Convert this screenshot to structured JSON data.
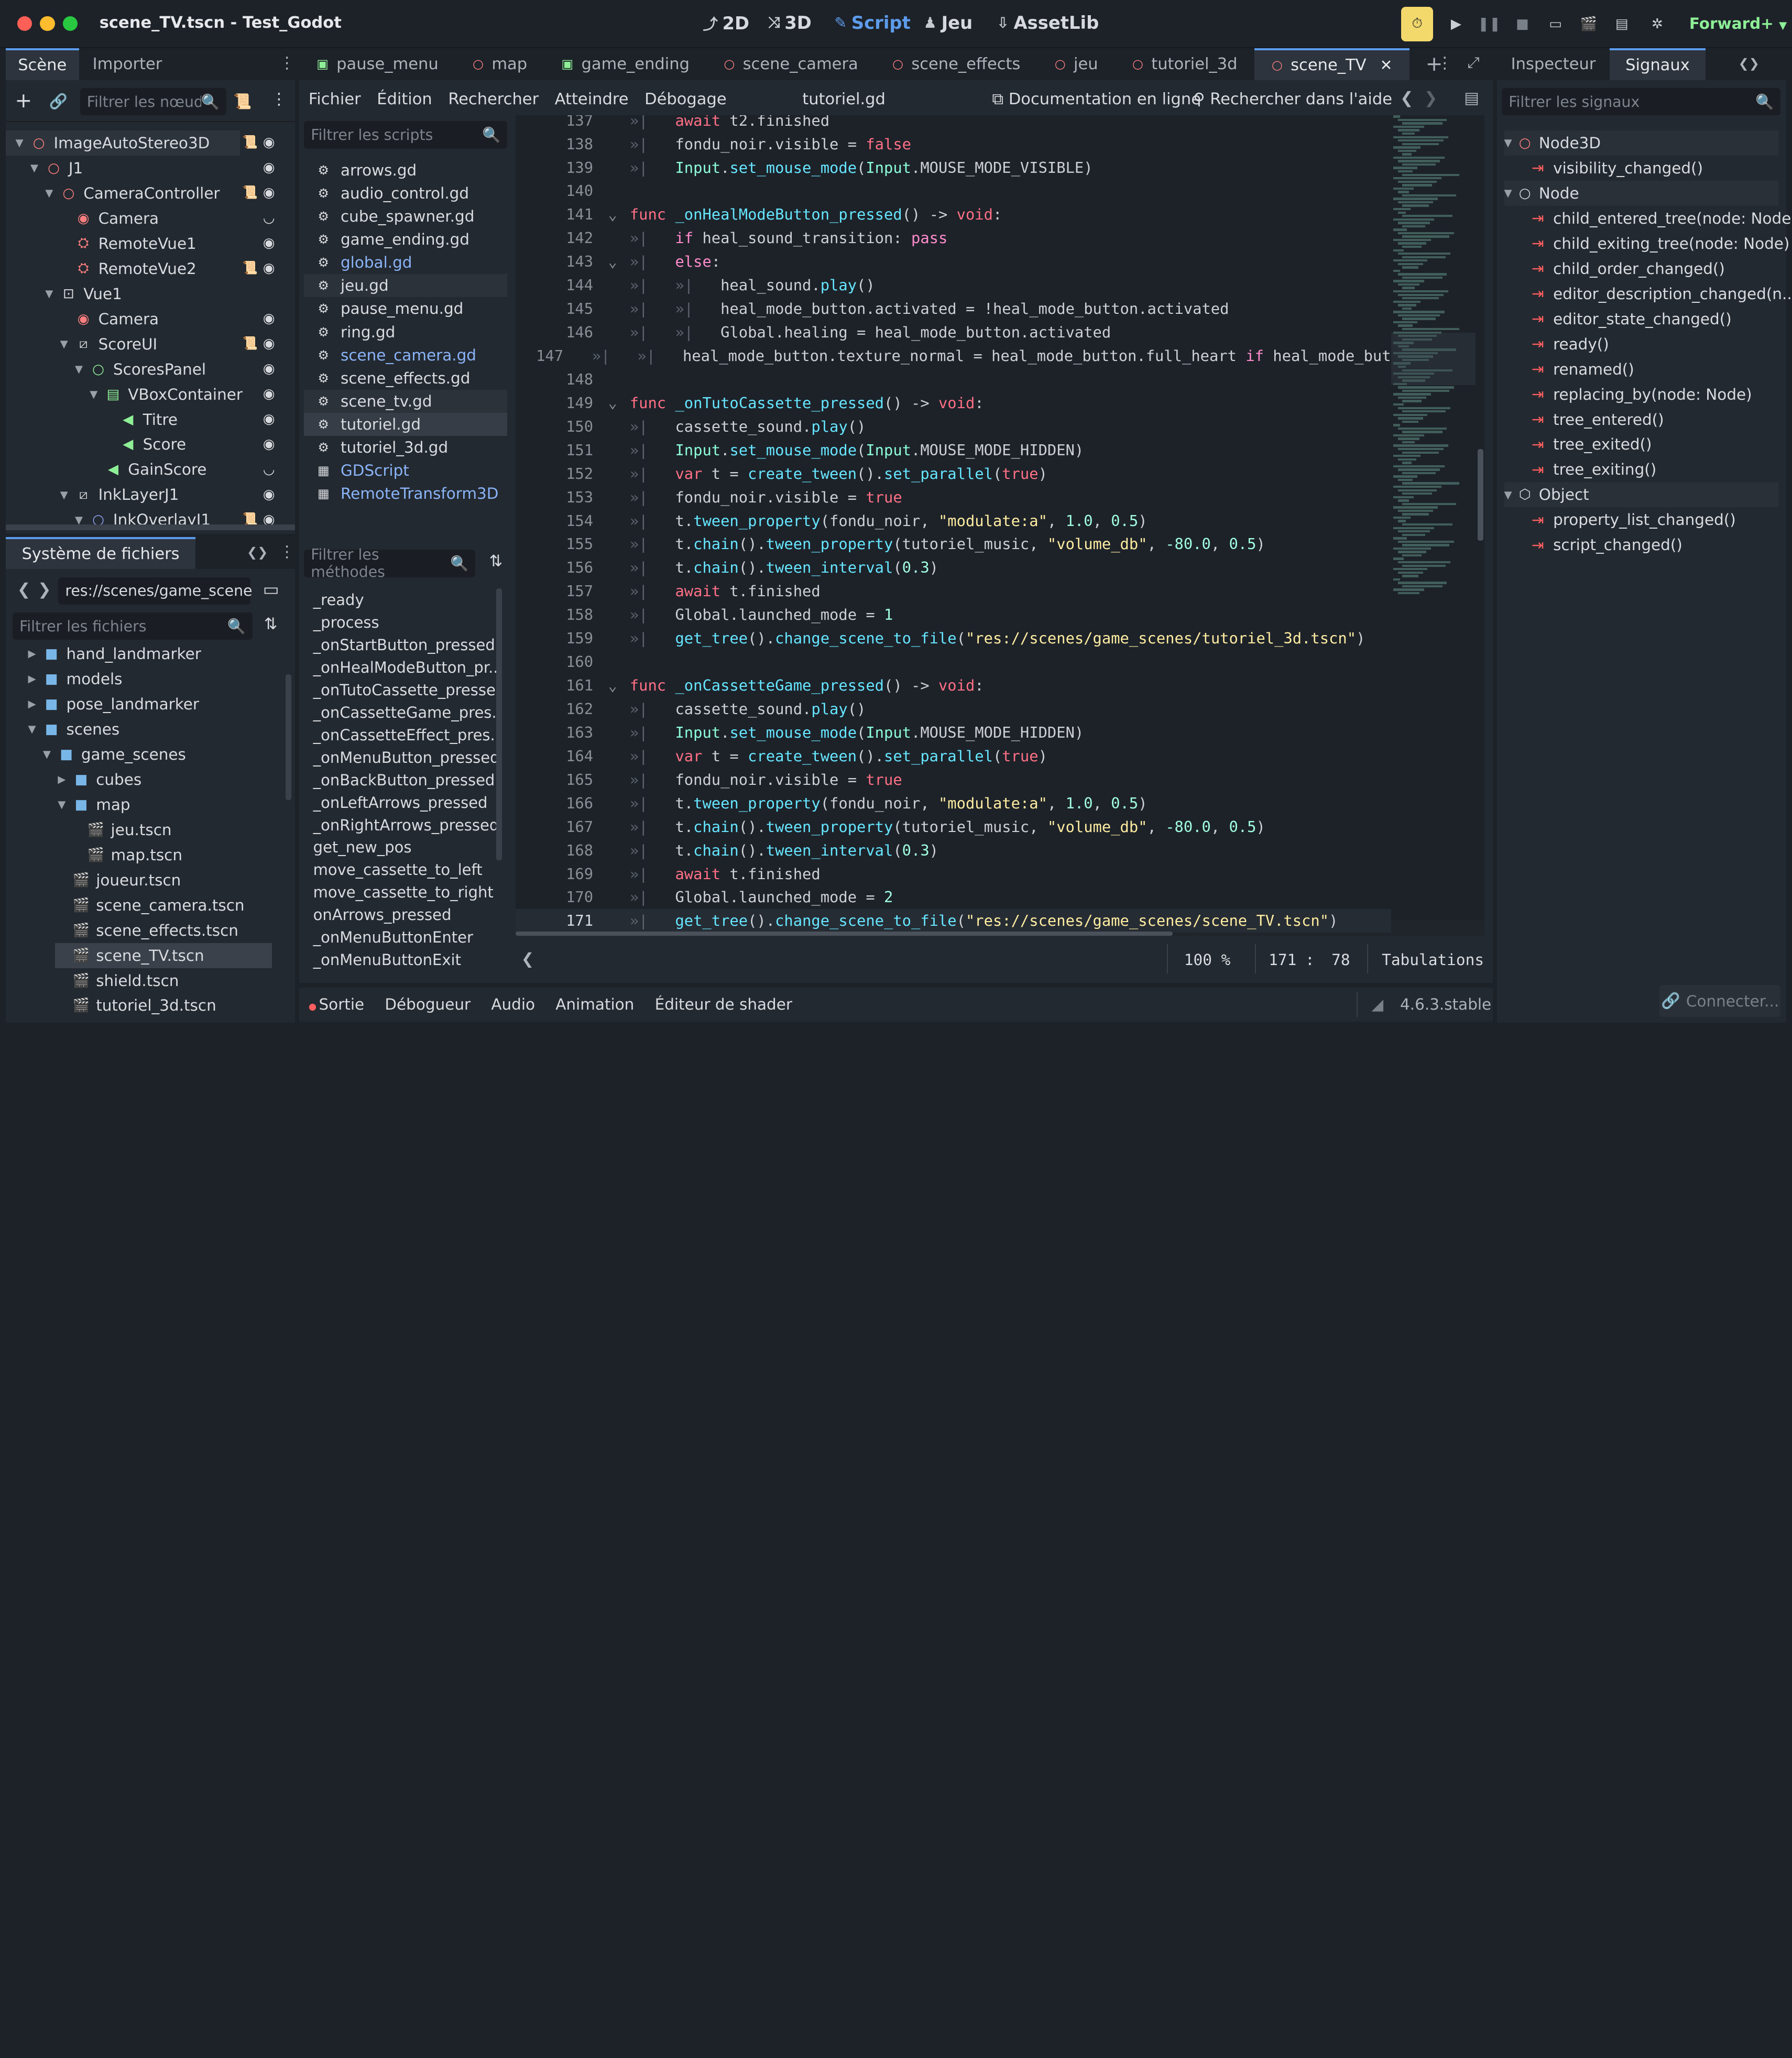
{
  "window": {
    "title": "scene_TV.tscn - Test_Godot"
  },
  "workspaces": [
    {
      "icon": "2D",
      "label": "2D"
    },
    {
      "icon": "3D",
      "label": "3D"
    },
    {
      "icon": "script",
      "label": "Script"
    },
    {
      "icon": "play",
      "label": "Jeu"
    },
    {
      "icon": "download",
      "label": "AssetLib"
    }
  ],
  "renderer": "Forward+",
  "left_dock": {
    "tabs": [
      "Scène",
      "Importer"
    ],
    "filter_placeholder": "Filtrer les nœuds",
    "tree": [
      {
        "label": "ImageAutoStereo3D",
        "icon": "node3d",
        "color": "#fc7f7f"
      },
      {
        "label": "J1",
        "icon": "node3d",
        "color": "#fc7f7f"
      },
      {
        "label": "CameraController",
        "icon": "node3d",
        "color": "#fc7f7f"
      },
      {
        "label": "Camera",
        "icon": "camera",
        "color": "#fc7f7f"
      },
      {
        "label": "RemoteVue1",
        "icon": "remote",
        "color": "#fc7f7f"
      },
      {
        "label": "RemoteVue2",
        "icon": "remote",
        "color": "#fc7f7f"
      },
      {
        "label": "Vue1",
        "icon": "subviewport",
        "color": "#d8dbdf"
      },
      {
        "label": "Camera",
        "icon": "camera",
        "color": "#fc7f7f"
      },
      {
        "label": "ScoreUI",
        "icon": "canvaslayer",
        "color": "#d8dbdf"
      },
      {
        "label": "ScoresPanel",
        "icon": "control",
        "color": "#8eef97"
      },
      {
        "label": "VBoxContainer",
        "icon": "vbox",
        "color": "#8eef97"
      },
      {
        "label": "Titre",
        "icon": "label",
        "color": "#8eef97"
      },
      {
        "label": "Score",
        "icon": "label",
        "color": "#8eef97"
      },
      {
        "label": "GainScore",
        "icon": "label",
        "color": "#8eef97"
      },
      {
        "label": "InkLayerJ1",
        "icon": "canvaslayer",
        "color": "#d8dbdf"
      },
      {
        "label": "InkOverlayJ1",
        "icon": "node2d",
        "color": "#8da5f3"
      }
    ]
  },
  "filesystem": {
    "title": "Système de fichiers",
    "path": "res://scenes/game_scene",
    "filter_placeholder": "Filtrer les fichiers",
    "items": [
      {
        "label": "hand_landmarker",
        "type": "folder"
      },
      {
        "label": "models",
        "type": "folder"
      },
      {
        "label": "pose_landmarker",
        "type": "folder"
      },
      {
        "label": "scenes",
        "type": "folder"
      },
      {
        "label": "game_scenes",
        "type": "folder"
      },
      {
        "label": "cubes",
        "type": "folder"
      },
      {
        "label": "map",
        "type": "folder"
      },
      {
        "label": "jeu.tscn",
        "type": "scene"
      },
      {
        "label": "map.tscn",
        "type": "scene"
      },
      {
        "label": "joueur.tscn",
        "type": "scene"
      },
      {
        "label": "scene_camera.tscn",
        "type": "scene"
      },
      {
        "label": "scene_effects.tscn",
        "type": "scene"
      },
      {
        "label": "scene_TV.tscn",
        "type": "scene"
      },
      {
        "label": "shield.tscn",
        "type": "scene"
      },
      {
        "label": "tutoriel_3d.tscn",
        "type": "scene"
      }
    ]
  },
  "scene_tabs": [
    {
      "label": "pause_menu",
      "icon": "control"
    },
    {
      "label": "map",
      "icon": "node3d"
    },
    {
      "label": "game_ending",
      "icon": "control"
    },
    {
      "label": "scene_camera",
      "icon": "node3d"
    },
    {
      "label": "scene_effects",
      "icon": "node3d"
    },
    {
      "label": "jeu",
      "icon": "node3d"
    },
    {
      "label": "tutoriel_3d",
      "icon": "node3d"
    },
    {
      "label": "scene_TV",
      "icon": "node3d"
    }
  ],
  "script_menu": [
    "Fichier",
    "Édition",
    "Rechercher",
    "Atteindre",
    "Débogage"
  ],
  "current_script": "tutoriel.gd",
  "doc_online": "Documentation en ligne",
  "search_help": "Rechercher dans l'aide",
  "scripts_filter_placeholder": "Filtrer les scripts",
  "scripts": [
    {
      "label": "arrows.gd",
      "cls": ""
    },
    {
      "label": "audio_control.gd",
      "cls": ""
    },
    {
      "label": "cube_spawner.gd",
      "cls": ""
    },
    {
      "label": "game_ending.gd",
      "cls": ""
    },
    {
      "label": "global.gd",
      "cls": "blue"
    },
    {
      "label": "jeu.gd",
      "cls": "hl"
    },
    {
      "label": "pause_menu.gd",
      "cls": ""
    },
    {
      "label": "ring.gd",
      "cls": ""
    },
    {
      "label": "scene_camera.gd",
      "cls": "blue"
    },
    {
      "label": "scene_effects.gd",
      "cls": ""
    },
    {
      "label": "scene_tv.gd",
      "cls": "hl"
    },
    {
      "label": "tutoriel.gd",
      "cls": "sel"
    },
    {
      "label": "tutoriel_3d.gd",
      "cls": ""
    },
    {
      "label": "GDScript",
      "cls": "blue doc"
    },
    {
      "label": "RemoteTransform3D",
      "cls": "blue doc"
    }
  ],
  "methods_filter_placeholder": "Filtrer les méthodes",
  "methods": [
    "_ready",
    "_process",
    "_onStartButton_pressed",
    "_onHealModeButton_pr...",
    "_onTutoCassette_pressed",
    "_onCassetteGame_pres...",
    "_onCassetteEffect_pres...",
    "_onMenuButton_pressed",
    "_onBackButton_pressed",
    "_onLeftArrows_pressed",
    "_onRightArrows_pressed",
    "get_new_pos",
    "move_cassette_to_left",
    "move_cassette_to_right",
    "onArrows_pressed",
    "_onMenuButtonEnter",
    "_onMenuButtonExit"
  ],
  "code_lines": [
    {
      "n": "137",
      "fold": "",
      "html": "<span class='ind'>»|</span>   <span class='kw'>await</span> t2.finished"
    },
    {
      "n": "138",
      "fold": "",
      "html": "<span class='ind'>»|</span>   fondu_noir.visible = <span class='kw'>false</span>"
    },
    {
      "n": "139",
      "fold": "",
      "html": "<span class='ind'>»|</span>   <span class='typ'>Input</span>.<span class='fn'>set_mouse_mode</span>(<span class='typ'>Input</span>.MOUSE_MODE_VISIBLE)"
    },
    {
      "n": "140",
      "fold": "",
      "html": ""
    },
    {
      "n": "141",
      "fold": "v",
      "html": "<span class='kw'>func</span> <span class='fn'>_onHealModeButton_pressed</span>() -> <span class='kw'>void</span>:"
    },
    {
      "n": "142",
      "fold": "",
      "html": "<span class='ind'>»|</span>   <span class='kwc'>if</span> heal_sound_transition: <span class='kwc'>pass</span>"
    },
    {
      "n": "143",
      "fold": "v",
      "html": "<span class='ind'>»|</span>   <span class='kwc'>else</span>:"
    },
    {
      "n": "144",
      "fold": "",
      "html": "<span class='ind'>»|</span>   <span class='ind'>»|</span>   heal_sound.<span class='fn'>play</span>()"
    },
    {
      "n": "145",
      "fold": "",
      "html": "<span class='ind'>»|</span>   <span class='ind'>»|</span>   heal_mode_button.activated = !heal_mode_button.activated"
    },
    {
      "n": "146",
      "fold": "",
      "html": "<span class='ind'>»|</span>   <span class='ind'>»|</span>   Global.healing = heal_mode_button.activated"
    },
    {
      "n": "147",
      "fold": "",
      "html": "<span class='ind'>»|</span>   <span class='ind'>»|</span>   heal_mode_button.texture_normal = heal_mode_button.full_heart <span class='kwc'>if</span> heal_mode_but"
    },
    {
      "n": "148",
      "fold": "",
      "html": ""
    },
    {
      "n": "149",
      "fold": "v",
      "html": "<span class='kw'>func</span> <span class='fn'>_onTutoCassette_pressed</span>() -> <span class='kw'>void</span>:"
    },
    {
      "n": "150",
      "fold": "",
      "html": "<span class='ind'>»|</span>   cassette_sound.<span class='fn'>play</span>()"
    },
    {
      "n": "151",
      "fold": "",
      "html": "<span class='ind'>»|</span>   <span class='typ'>Input</span>.<span class='fn'>set_mouse_mode</span>(<span class='typ'>Input</span>.MOUSE_MODE_HIDDEN)"
    },
    {
      "n": "152",
      "fold": "",
      "html": "<span class='ind'>»|</span>   <span class='kw'>var</span> t = <span class='fn'>create_tween</span>().<span class='fn'>set_parallel</span>(<span class='kw'>true</span>)"
    },
    {
      "n": "153",
      "fold": "",
      "html": "<span class='ind'>»|</span>   fondu_noir.visible = <span class='kw'>true</span>"
    },
    {
      "n": "154",
      "fold": "",
      "html": "<span class='ind'>»|</span>   t.<span class='fn'>tween_property</span>(fondu_noir, <span class='str'>\"modulate:a\"</span>, <span class='num'>1.0</span>, <span class='num'>0.5</span>)"
    },
    {
      "n": "155",
      "fold": "",
      "html": "<span class='ind'>»|</span>   t.<span class='fn'>chain</span>().<span class='fn'>tween_property</span>(tutoriel_music, <span class='str'>\"volume_db\"</span>, <span class='num'>-80.0</span>, <span class='num'>0.5</span>)"
    },
    {
      "n": "156",
      "fold": "",
      "html": "<span class='ind'>»|</span>   t.<span class='fn'>chain</span>().<span class='fn'>tween_interval</span>(<span class='num'>0.3</span>)"
    },
    {
      "n": "157",
      "fold": "",
      "html": "<span class='ind'>»|</span>   <span class='kw'>await</span> t.finished"
    },
    {
      "n": "158",
      "fold": "",
      "html": "<span class='ind'>»|</span>   Global.launched_mode = <span class='num'>1</span>"
    },
    {
      "n": "159",
      "fold": "",
      "html": "<span class='ind'>»|</span>   <span class='fn'>get_tree</span>().<span class='fn'>change_scene_to_file</span>(<span class='str'>\"res://scenes/game_scenes/tutoriel_3d.tscn\"</span>)"
    },
    {
      "n": "160",
      "fold": "",
      "html": ""
    },
    {
      "n": "161",
      "fold": "v",
      "html": "<span class='kw'>func</span> <span class='fn'>_onCassetteGame_pressed</span>() -> <span class='kw'>void</span>:"
    },
    {
      "n": "162",
      "fold": "",
      "html": "<span class='ind'>»|</span>   cassette_sound.<span class='fn'>play</span>()"
    },
    {
      "n": "163",
      "fold": "",
      "html": "<span class='ind'>»|</span>   <span class='typ'>Input</span>.<span class='fn'>set_mouse_mode</span>(<span class='typ'>Input</span>.MOUSE_MODE_HIDDEN)"
    },
    {
      "n": "164",
      "fold": "",
      "html": "<span class='ind'>»|</span>   <span class='kw'>var</span> t = <span class='fn'>create_tween</span>().<span class='fn'>set_parallel</span>(<span class='kw'>true</span>)"
    },
    {
      "n": "165",
      "fold": "",
      "html": "<span class='ind'>»|</span>   fondu_noir.visible = <span class='kw'>true</span>"
    },
    {
      "n": "166",
      "fold": "",
      "html": "<span class='ind'>»|</span>   t.<span class='fn'>tween_property</span>(fondu_noir, <span class='str'>\"modulate:a\"</span>, <span class='num'>1.0</span>, <span class='num'>0.5</span>)"
    },
    {
      "n": "167",
      "fold": "",
      "html": "<span class='ind'>»|</span>   t.<span class='fn'>chain</span>().<span class='fn'>tween_property</span>(tutoriel_music, <span class='str'>\"volume_db\"</span>, <span class='num'>-80.0</span>, <span class='num'>0.5</span>)"
    },
    {
      "n": "168",
      "fold": "",
      "html": "<span class='ind'>»|</span>   t.<span class='fn'>chain</span>().<span class='fn'>tween_interval</span>(<span class='num'>0.3</span>)"
    },
    {
      "n": "169",
      "fold": "",
      "html": "<span class='ind'>»|</span>   <span class='kw'>await</span> t.finished"
    },
    {
      "n": "170",
      "fold": "",
      "html": "<span class='ind'>»|</span>   Global.launched_mode = <span class='num'>2</span>"
    },
    {
      "n": "171",
      "fold": "",
      "html": "<span class='ind'>»|</span>   <span class='fn'>get_tree</span>().<span class='fn'>change_scene_to_file</span>(<span class='str'>\"res://scenes/game_scenes/scene_TV.tscn\"</span>)"
    }
  ],
  "status": {
    "zoom": "100 %",
    "line": "171",
    "sep": ":",
    "col": "78",
    "indent": "Tabulations"
  },
  "bottom_tabs": [
    "Sortie",
    "Débogueur",
    "Audio",
    "Animation",
    "Éditeur de shader"
  ],
  "version": "4.6.3.stable",
  "right_dock": {
    "tabs": [
      "Inspecteur",
      "Signaux"
    ],
    "filter_placeholder": "Filtrer les signaux",
    "connect_button": "Connecter...",
    "groups": [
      {
        "name": "Node3D",
        "icon": "node3d",
        "signals": [
          "visibility_changed()"
        ]
      },
      {
        "name": "Node",
        "icon": "node",
        "signals": [
          "child_entered_tree(node: Node)",
          "child_exiting_tree(node: Node)",
          "child_order_changed()",
          "editor_description_changed(n...",
          "editor_state_changed()",
          "ready()",
          "renamed()",
          "replacing_by(node: Node)",
          "tree_entered()",
          "tree_exited()",
          "tree_exiting()"
        ]
      },
      {
        "name": "Object",
        "icon": "object",
        "signals": [
          "property_list_changed()",
          "script_changed()"
        ]
      }
    ]
  },
  "colors": {
    "accent": "#5d9cec",
    "node3d": "#fc7f7f",
    "control": "#8eef97",
    "signal": "#ff5f5f"
  }
}
